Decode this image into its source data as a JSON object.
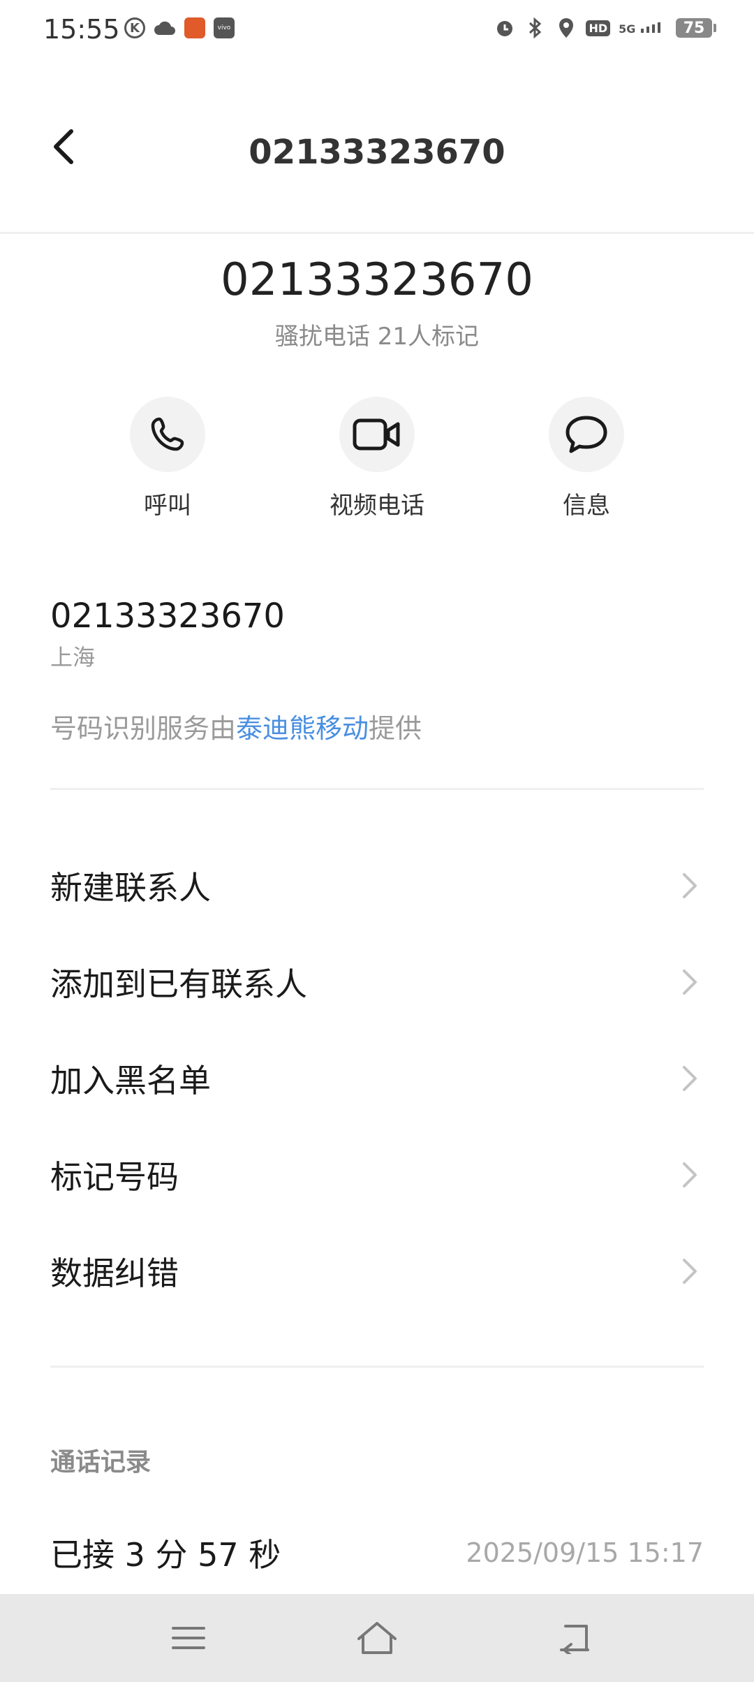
{
  "status_bar": {
    "time": "15:55",
    "battery": "75",
    "icons_left": [
      "k-icon",
      "cloud-icon",
      "app-icon",
      "vivo-icon"
    ],
    "icons_right": [
      "alarm-icon",
      "bluetooth-icon",
      "location-icon",
      "hd-icon",
      "5g-signal-icon",
      "battery-icon"
    ],
    "hd_label": "HD",
    "network_label": "5G"
  },
  "header": {
    "title": "02133323670"
  },
  "number_info": {
    "number": "02133323670",
    "tag": "骚扰电话 21人标记"
  },
  "actions": [
    {
      "label": "呼叫",
      "icon": "phone-icon"
    },
    {
      "label": "视频电话",
      "icon": "video-icon"
    },
    {
      "label": "信息",
      "icon": "message-icon"
    }
  ],
  "detail": {
    "number": "02133323670",
    "location": "上海",
    "provider_prefix": "号码识别服务由",
    "provider_link": "泰迪熊移动",
    "provider_suffix": "提供"
  },
  "menu": [
    {
      "label": "新建联系人"
    },
    {
      "label": "添加到已有联系人"
    },
    {
      "label": "加入黑名单"
    },
    {
      "label": "标记号码"
    },
    {
      "label": "数据纠错"
    }
  ],
  "call_log": {
    "title": "通话记录",
    "entries": [
      {
        "status": "已接 3 分 57 秒",
        "time": "2025/09/15 15:17"
      }
    ]
  },
  "colors": {
    "link": "#4a8fe0",
    "nav_bg": "#e8e8e8"
  }
}
